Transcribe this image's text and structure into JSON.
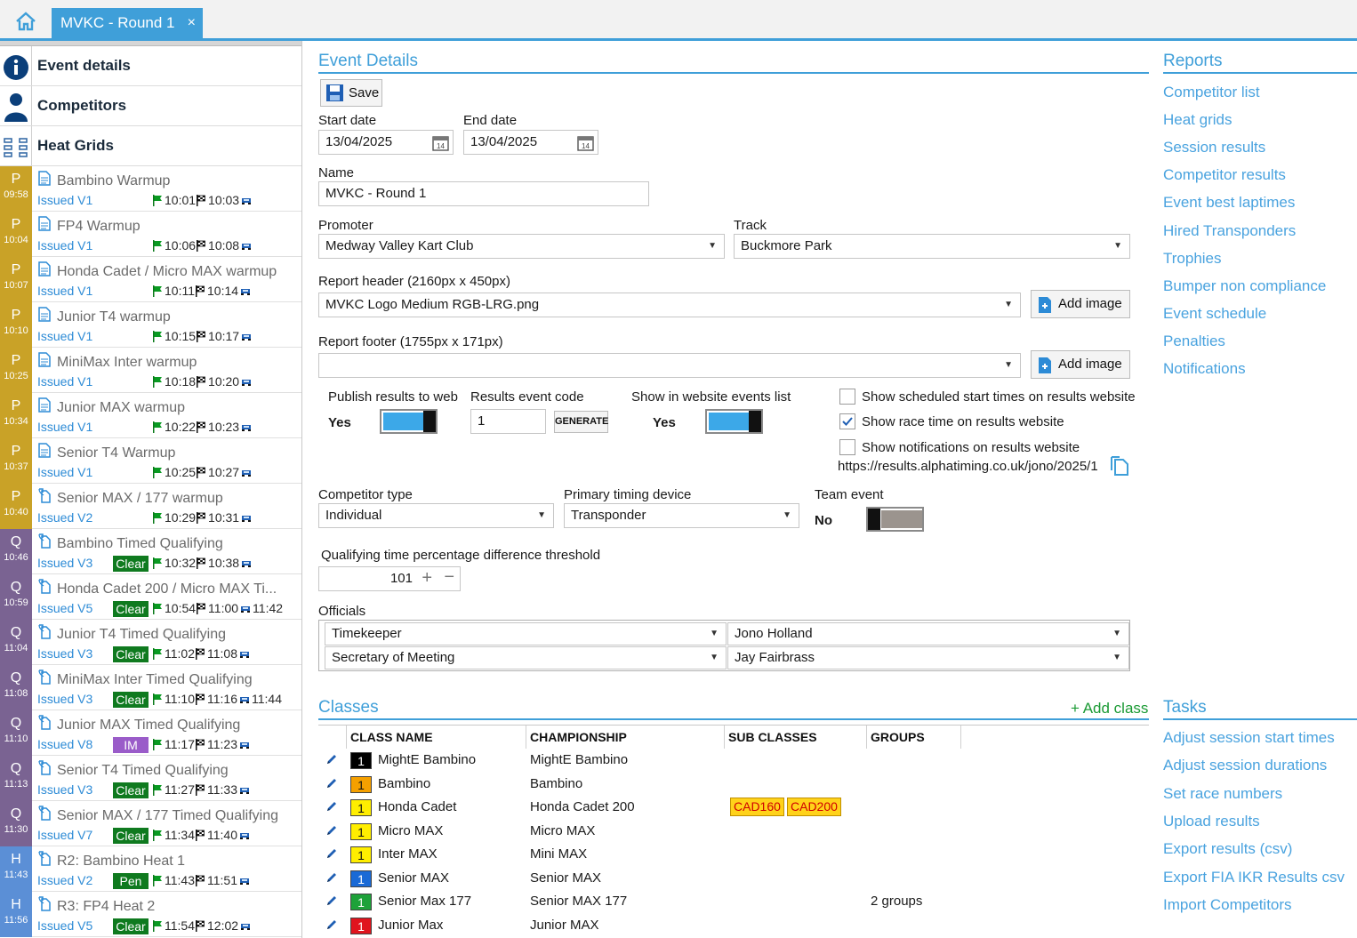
{
  "tab": {
    "title": "MVKC - Round 1",
    "close": "×"
  },
  "nav": {
    "event_details": "Event details",
    "competitors": "Competitors",
    "heat_grids": "Heat Grids"
  },
  "sessions": [
    {
      "letter": "P",
      "time": "09:58",
      "name": "Bambino Warmup",
      "issued": "Issued V1",
      "status": "",
      "start": "10:01",
      "end": "10:03",
      "extra": ""
    },
    {
      "letter": "P",
      "time": "10:04",
      "name": "FP4 Warmup",
      "issued": "Issued V1",
      "status": "",
      "start": "10:06",
      "end": "10:08",
      "extra": ""
    },
    {
      "letter": "P",
      "time": "10:07",
      "name": "Honda Cadet / Micro MAX warmup",
      "issued": "Issued V1",
      "status": "",
      "start": "10:11",
      "end": "10:14",
      "extra": ""
    },
    {
      "letter": "P",
      "time": "10:10",
      "name": "Junior T4 warmup",
      "issued": "Issued V1",
      "status": "",
      "start": "10:15",
      "end": "10:17",
      "extra": ""
    },
    {
      "letter": "P",
      "time": "10:25",
      "name": "MiniMax Inter warmup",
      "issued": "Issued V1",
      "status": "",
      "start": "10:18",
      "end": "10:20",
      "extra": ""
    },
    {
      "letter": "P",
      "time": "10:34",
      "name": "Junior MAX warmup",
      "issued": "Issued V1",
      "status": "",
      "start": "10:22",
      "end": "10:23",
      "extra": ""
    },
    {
      "letter": "P",
      "time": "10:37",
      "name": "Senior T4 Warmup",
      "issued": "Issued V1",
      "status": "",
      "start": "10:25",
      "end": "10:27",
      "extra": ""
    },
    {
      "letter": "P",
      "time": "10:40",
      "name": "Senior MAX / 177 warmup",
      "issued": "Issued V2",
      "status": "",
      "start": "10:29",
      "end": "10:31",
      "extra": ""
    },
    {
      "letter": "Q",
      "time": "10:46",
      "name": "Bambino Timed Qualifying",
      "issued": "Issued V3",
      "status": "Clear",
      "start": "10:32",
      "end": "10:38",
      "extra": ""
    },
    {
      "letter": "Q",
      "time": "10:59",
      "name": "Honda Cadet 200 / Micro MAX Ti...",
      "issued": "Issued V5",
      "status": "Clear",
      "start": "10:54",
      "end": "11:00",
      "extra": "11:42"
    },
    {
      "letter": "Q",
      "time": "11:04",
      "name": "Junior T4 Timed Qualifying",
      "issued": "Issued V3",
      "status": "Clear",
      "start": "11:02",
      "end": "11:08",
      "extra": ""
    },
    {
      "letter": "Q",
      "time": "11:08",
      "name": "MiniMax Inter Timed Qualifying",
      "issued": "Issued V3",
      "status": "Clear",
      "start": "11:10",
      "end": "11:16",
      "extra": "11:44"
    },
    {
      "letter": "Q",
      "time": "11:10",
      "name": "Junior MAX Timed Qualifying",
      "issued": "Issued V8",
      "status": "IM",
      "start": "11:17",
      "end": "11:23",
      "extra": ""
    },
    {
      "letter": "Q",
      "time": "11:13",
      "name": "Senior T4 Timed Qualifying",
      "issued": "Issued V3",
      "status": "Clear",
      "start": "11:27",
      "end": "11:33",
      "extra": ""
    },
    {
      "letter": "Q",
      "time": "11:30",
      "name": "Senior MAX / 177 Timed Qualifying",
      "issued": "Issued V7",
      "status": "Clear",
      "start": "11:34",
      "end": "11:40",
      "extra": ""
    },
    {
      "letter": "H",
      "time": "11:43",
      "name": "R2: Bambino Heat 1",
      "issued": "Issued V2",
      "status": "Pen",
      "start": "11:43",
      "end": "11:51",
      "extra": ""
    },
    {
      "letter": "H",
      "time": "11:56",
      "name": "R3: FP4 Heat 2",
      "issued": "Issued V5",
      "status": "Clear",
      "start": "11:54",
      "end": "12:02",
      "extra": ""
    }
  ],
  "badge_colors": {
    "P": "#c9a227",
    "Q": "#7a6392",
    "H": "#5b8fd6"
  },
  "event": {
    "heading": "Event Details",
    "save": "Save",
    "start_date_label": "Start date",
    "start_date": "13/04/2025",
    "end_date_label": "End date",
    "end_date": "13/04/2025",
    "name_label": "Name",
    "name": "MVKC - Round 1",
    "promoter_label": "Promoter",
    "promoter": "Medway Valley Kart Club",
    "track_label": "Track",
    "track": "Buckmore Park",
    "report_header_label": "Report header (2160px x 450px)",
    "report_header": "MVKC Logo Medium RGB-LRG.png",
    "report_footer_label": "Report footer (1755px x 171px)",
    "report_footer": "",
    "add_image": "Add image",
    "publish_label": "Publish results to web",
    "publish_value": "Yes",
    "event_code_label": "Results event code",
    "event_code": "1",
    "generate": "GENERATE",
    "show_list_label": "Show in website events list",
    "show_list_value": "Yes",
    "cb_scheduled": "Show scheduled start times on results website",
    "cb_race_time": "Show race time on results website",
    "cb_notifications": "Show notifications on results website",
    "results_url": "https://results.alphatiming.co.uk/jono/2025/1",
    "competitor_type_label": "Competitor type",
    "competitor_type": "Individual",
    "timing_device_label": "Primary timing device",
    "timing_device": "Transponder",
    "team_event_label": "Team event",
    "team_event_value": "No",
    "qual_threshold_label": "Qualifying time percentage difference threshold",
    "qual_threshold": "101",
    "officials_label": "Officials",
    "officials": [
      {
        "role": "Timekeeper",
        "person": "Jono Holland"
      },
      {
        "role": "Secretary of Meeting",
        "person": "Jay Fairbrass"
      }
    ]
  },
  "classes": {
    "heading": "Classes",
    "add": "+ Add class",
    "columns": [
      "CLASS NAME",
      "CHAMPIONSHIP",
      "SUB CLASSES",
      "GROUPS"
    ],
    "rows": [
      {
        "num": "1",
        "color": "#000000",
        "text_color": "#ffffff",
        "name": "MightE Bambino",
        "championship": "MightE Bambino",
        "sub": [],
        "groups": ""
      },
      {
        "num": "1",
        "color": "#f5a000",
        "text_color": "#111111",
        "name": "Bambino",
        "championship": "Bambino",
        "sub": [],
        "groups": ""
      },
      {
        "num": "1",
        "color": "#ffee00",
        "text_color": "#111111",
        "name": "Honda Cadet",
        "championship": "Honda Cadet 200",
        "sub": [
          "CAD160",
          "CAD200"
        ],
        "groups": ""
      },
      {
        "num": "1",
        "color": "#ffee00",
        "text_color": "#111111",
        "name": "Micro MAX",
        "championship": "Micro MAX",
        "sub": [],
        "groups": ""
      },
      {
        "num": "1",
        "color": "#ffee00",
        "text_color": "#111111",
        "name": "Inter MAX",
        "championship": "Mini MAX",
        "sub": [],
        "groups": ""
      },
      {
        "num": "1",
        "color": "#1a6ad6",
        "text_color": "#ffffff",
        "name": "Senior MAX",
        "championship": "Senior MAX",
        "sub": [],
        "groups": ""
      },
      {
        "num": "1",
        "color": "#1ea23a",
        "text_color": "#ffffff",
        "name": "Senior Max 177",
        "championship": "Senior MAX 177",
        "sub": [],
        "groups": "2 groups"
      },
      {
        "num": "1",
        "color": "#e0141e",
        "text_color": "#ffffff",
        "name": "Junior Max",
        "championship": "Junior MAX",
        "sub": [],
        "groups": ""
      }
    ]
  },
  "reports": {
    "heading": "Reports",
    "items": [
      "Competitor list",
      "Heat grids",
      "Session results",
      "Competitor results",
      "Event best laptimes",
      "Hired Transponders",
      "Trophies",
      "Bumper non compliance",
      "Event schedule",
      "Penalties",
      "Notifications"
    ]
  },
  "tasks": {
    "heading": "Tasks",
    "items": [
      "Adjust session start times",
      "Adjust session durations",
      "Set race numbers",
      "Upload results",
      "Export results (csv)",
      "Export FIA IKR Results csv",
      "Import Competitors"
    ]
  },
  "colors": {
    "accent": "#3f9fd9",
    "link": "#4aa3df",
    "issued": "#2d8bd6",
    "clear": "#0f7a1f",
    "im": "#9a5cc9"
  },
  "icons": {
    "home": "home-icon",
    "info": "info-icon",
    "person": "person-icon",
    "grid": "grid-icon",
    "doc": "document-icon",
    "reissued": "reissued-document-icon",
    "green_flag": "green-flag-icon",
    "checkered_flag": "checkered-flag-icon",
    "car": "car-icon",
    "save": "floppy-disk-icon",
    "calendar": "calendar-icon",
    "add_image": "add-image-icon",
    "copy": "copy-icon",
    "edit": "pencil-icon"
  }
}
